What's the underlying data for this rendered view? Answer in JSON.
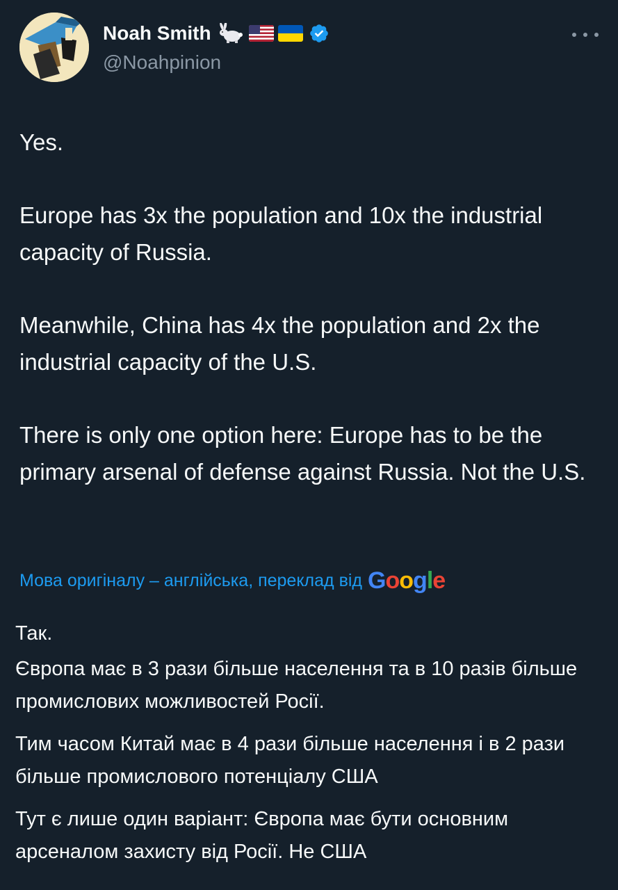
{
  "author": {
    "display_name": "Noah Smith",
    "handle": "@Noahpinion",
    "badges": [
      "rabbit-emoji",
      "us-flag-emoji",
      "ukraine-flag-emoji",
      "verified-badge"
    ],
    "verified_color": "#1d9bf0"
  },
  "tweet": {
    "paragraphs": [
      "Yes.",
      "Europe has 3x the population and 10x the industrial capacity of Russia.",
      "Meanwhile, China has 4x the population and 2x the industrial capacity of the U.S.",
      "There is only one option here: Europe has to be the primary arsenal of defense against Russia. Not the U.S."
    ]
  },
  "translation": {
    "label": "Мова оригіналу – англійська, переклад від",
    "provider": "Google",
    "provider_letters": [
      "G",
      "o",
      "o",
      "g",
      "l",
      "e"
    ],
    "provider_colors": [
      "#4285f4",
      "#ea4335",
      "#fbbc05",
      "#4285f4",
      "#34a853",
      "#ea4335"
    ],
    "paragraphs": [
      "Так.",
      "Європа має в 3 рази більше населення та в 10 разів більше промислових можливостей Росії.",
      "Тим часом Китай має в 4 рази більше населення і в 2 рази більше промислового потенціалу США",
      "Тут є лише один варіант: Європа має бути основним арсеналом захисту від Росії. Не США"
    ]
  },
  "colors": {
    "background": "#15202b",
    "text": "#f7f9f9",
    "secondary_text": "#8b98a5",
    "accent": "#1d9bf0"
  }
}
